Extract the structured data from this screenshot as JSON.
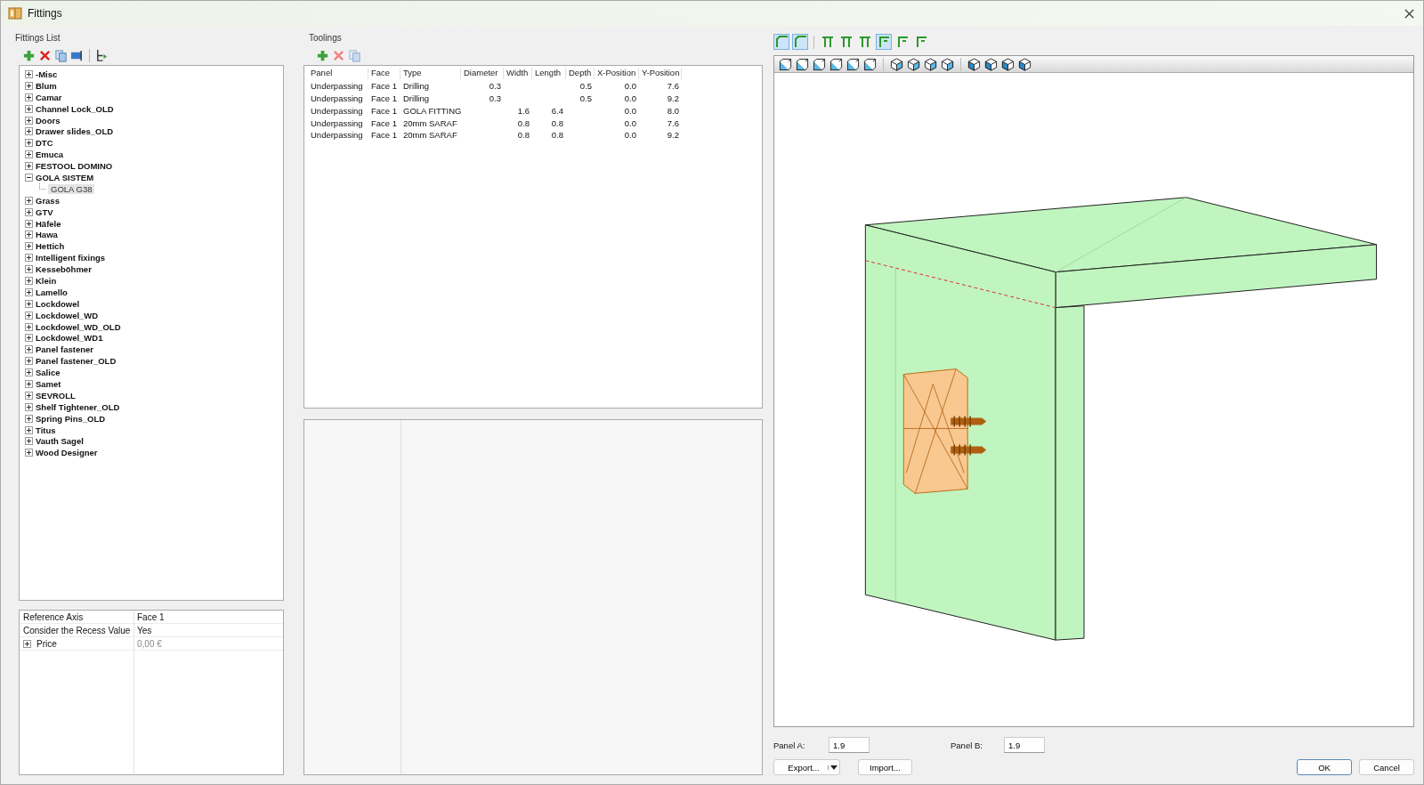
{
  "window": {
    "title": "Fittings"
  },
  "fittings_list": {
    "title": "Fittings List",
    "items": [
      {
        "label": "-Misc",
        "expanded": false
      },
      {
        "label": "Blum",
        "expanded": false
      },
      {
        "label": "Camar",
        "expanded": false
      },
      {
        "label": "Channel Lock_OLD",
        "expanded": false
      },
      {
        "label": "Doors",
        "expanded": false
      },
      {
        "label": "Drawer slides_OLD",
        "expanded": false
      },
      {
        "label": "DTC",
        "expanded": false
      },
      {
        "label": "Emuca",
        "expanded": false
      },
      {
        "label": "FESTOOL DOMINO",
        "expanded": false
      },
      {
        "label": "GOLA SISTEM",
        "expanded": true,
        "children": [
          {
            "label": "GOLA G38",
            "selected": true
          }
        ]
      },
      {
        "label": "Grass",
        "expanded": false
      },
      {
        "label": "GTV",
        "expanded": false
      },
      {
        "label": "Häfele",
        "expanded": false
      },
      {
        "label": "Hawa",
        "expanded": false
      },
      {
        "label": "Hettich",
        "expanded": false
      },
      {
        "label": "Intelligent fixings",
        "expanded": false
      },
      {
        "label": "Kesseböhmer",
        "expanded": false
      },
      {
        "label": "Klein",
        "expanded": false
      },
      {
        "label": "Lamello",
        "expanded": false
      },
      {
        "label": "Lockdowel",
        "expanded": false
      },
      {
        "label": "Lockdowel_WD",
        "expanded": false
      },
      {
        "label": "Lockdowel_WD_OLD",
        "expanded": false
      },
      {
        "label": "Lockdowel_WD1",
        "expanded": false
      },
      {
        "label": "Panel fastener",
        "expanded": false
      },
      {
        "label": "Panel fastener_OLD",
        "expanded": false
      },
      {
        "label": "Salice",
        "expanded": false
      },
      {
        "label": "Samet",
        "expanded": false
      },
      {
        "label": "SEVROLL",
        "expanded": false
      },
      {
        "label": "Shelf Tightener_OLD",
        "expanded": false
      },
      {
        "label": "Spring Pins_OLD",
        "expanded": false
      },
      {
        "label": "Titus",
        "expanded": false
      },
      {
        "label": "Vauth Sagel",
        "expanded": false
      },
      {
        "label": "Wood Designer",
        "expanded": false
      }
    ]
  },
  "properties": [
    {
      "name": "Reference Axis",
      "value": "Face 1",
      "kind": "plain"
    },
    {
      "name": "Consider the Recess Value",
      "value": "Yes",
      "kind": "plain"
    },
    {
      "name": "Price",
      "value": "0,00 €",
      "kind": "group"
    }
  ],
  "toolings": {
    "title": "Toolings",
    "columns": [
      "Panel",
      "Face",
      "Type",
      "Diameter",
      "Width",
      "Length",
      "Depth",
      "X-Position",
      "Y-Position"
    ],
    "rows": [
      [
        "Underpassing",
        "Face 1",
        "Drilling",
        "0.3",
        "",
        "",
        "0.5",
        "0.0",
        "7.6"
      ],
      [
        "Underpassing",
        "Face 1",
        "Drilling",
        "0.3",
        "",
        "",
        "0.5",
        "0.0",
        "9.2"
      ],
      [
        "Underpassing",
        "Face 1",
        "GOLA FITTING",
        "",
        "1.6",
        "6.4",
        "",
        "0.0",
        "8.0"
      ],
      [
        "Underpassing",
        "Face 1",
        "20mm SARAF",
        "",
        "0.8",
        "0.8",
        "",
        "0.0",
        "7.6"
      ],
      [
        "Underpassing",
        "Face 1",
        "20mm SARAF",
        "",
        "0.8",
        "0.8",
        "",
        "0.0",
        "9.2"
      ]
    ]
  },
  "corner_modes": [
    {
      "selected": true
    },
    {
      "selected": true
    }
  ],
  "joint_modes": [
    {
      "selected": false
    },
    {
      "selected": false
    },
    {
      "selected": false
    },
    {
      "selected": true
    },
    {
      "selected": false
    },
    {
      "selected": false
    }
  ],
  "panel_a": {
    "label": "Panel A:",
    "value": "1.9"
  },
  "panel_b": {
    "label": "Panel B:",
    "value": "1.9"
  },
  "buttons": [
    {
      "label": "Export...",
      "kind": "split"
    },
    {
      "label": "Import...",
      "kind": "plain"
    },
    {
      "label": "OK",
      "kind": "default"
    },
    {
      "label": "Cancel",
      "kind": "plain"
    }
  ]
}
